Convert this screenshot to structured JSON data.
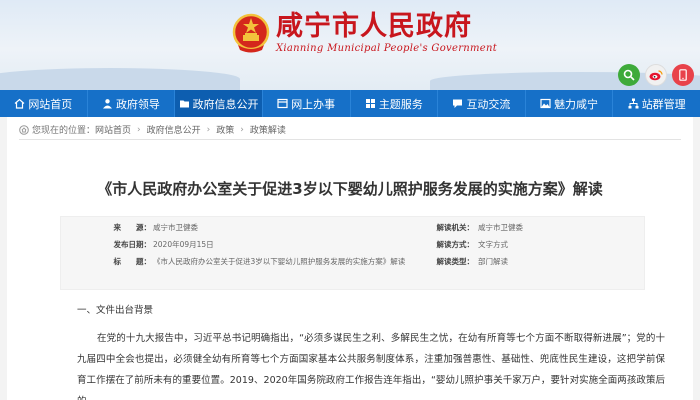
{
  "site": {
    "title_cn": "咸宁市人民政府",
    "title_en": "Xianning Municipal People's Government",
    "icons": [
      "search-icon",
      "weibo-icon",
      "mobile-icon"
    ]
  },
  "nav": {
    "items": [
      {
        "label": "网站首页",
        "icon": "home-icon"
      },
      {
        "label": "政府领导",
        "icon": "people-icon"
      },
      {
        "label": "政府信息公开",
        "icon": "folder-icon"
      },
      {
        "label": "网上办事",
        "icon": "window-icon"
      },
      {
        "label": "主题服务",
        "icon": "grid-icon"
      },
      {
        "label": "互动交流",
        "icon": "chat-icon"
      },
      {
        "label": "魅力咸宁",
        "icon": "photo-icon"
      },
      {
        "label": "站群管理",
        "icon": "sitemap-icon"
      }
    ],
    "active_index": 2
  },
  "breadcrumb": {
    "prefix": "您现在的位置：",
    "items": [
      "网站首页",
      "政府信息公开",
      "政策",
      "政策解读"
    ]
  },
  "article": {
    "title": "《市人民政府办公室关于促进3岁以下婴幼儿照护服务发展的实施方案》解读",
    "meta": {
      "source_label": "来　　源：",
      "source_value": "咸宁市卫健委",
      "date_label": "发布日期：",
      "date_value": "2020年09月15日",
      "title_label": "标　　题：",
      "title_value": "《市人民政府办公室关于促进3岁以下婴幼儿照护服务发展的实施方案》解读",
      "org_label": "解读机关：",
      "org_value": "咸宁市卫健委",
      "method_label": "解读方式：",
      "method_value": "文字方式",
      "type_label": "解读类型：",
      "type_value": "部门解读"
    },
    "section_heading": "一、文件出台背景",
    "paragraph": "在党的十九大报告中，习近平总书记明确指出，“必须多谋民生之利、多解民生之忧，在幼有所育等七个方面不断取得新进展”；党的十九届四中全会也提出，必须健全幼有所育等七个方面国家基本公共服务制度体系，注重加强普惠性、基础性、兜底性民生建设，这把学前保育工作摆在了前所未有的重要位置。2019、2020年国务院政府工作报告连年指出，“婴幼儿照护事关千家万户，要针对实施全面两孩政策后的"
  },
  "colors": {
    "brand_red": "#c8161d",
    "nav_blue": "#1670c8",
    "search_green": "#3eaa3a",
    "mobile_red": "#e8424a"
  }
}
